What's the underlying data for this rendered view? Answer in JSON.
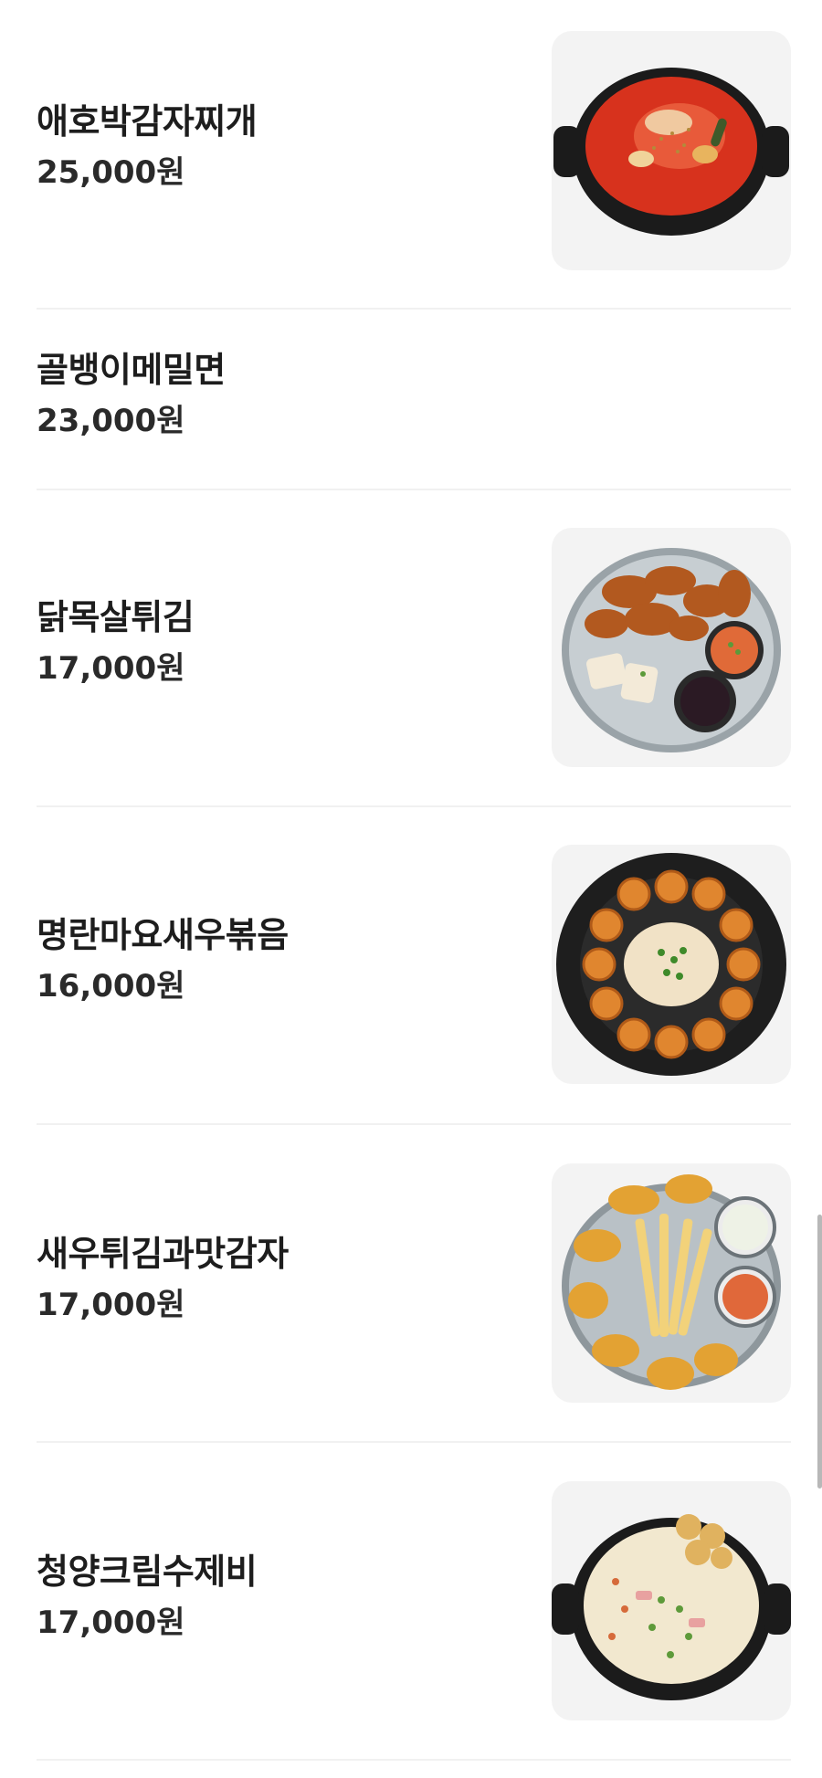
{
  "menu": {
    "items": [
      {
        "name": "애호박감자찌개",
        "price": "25,000원",
        "has_image": true,
        "image_icon": "kimchi-stew-pot-icon"
      },
      {
        "name": "골뱅이메밀면",
        "price": "23,000원",
        "has_image": false
      },
      {
        "name": "닭목살튀김",
        "price": "17,000원",
        "has_image": true,
        "image_icon": "fried-chicken-plate-icon"
      },
      {
        "name": "명란마요새우볶음",
        "price": "16,000원",
        "has_image": true,
        "image_icon": "shrimp-dark-plate-icon"
      },
      {
        "name": "새우튀김과맛감자",
        "price": "17,000원",
        "has_image": true,
        "image_icon": "fried-shrimp-fries-plate-icon"
      },
      {
        "name": "청양크림수제비",
        "price": "17,000원",
        "has_image": true,
        "image_icon": "cream-sujebi-pot-icon"
      }
    ]
  },
  "colors": {
    "text": "#1d1d1d",
    "divider": "#f1f1f1",
    "thumb_bg": "#f3f3f3"
  }
}
